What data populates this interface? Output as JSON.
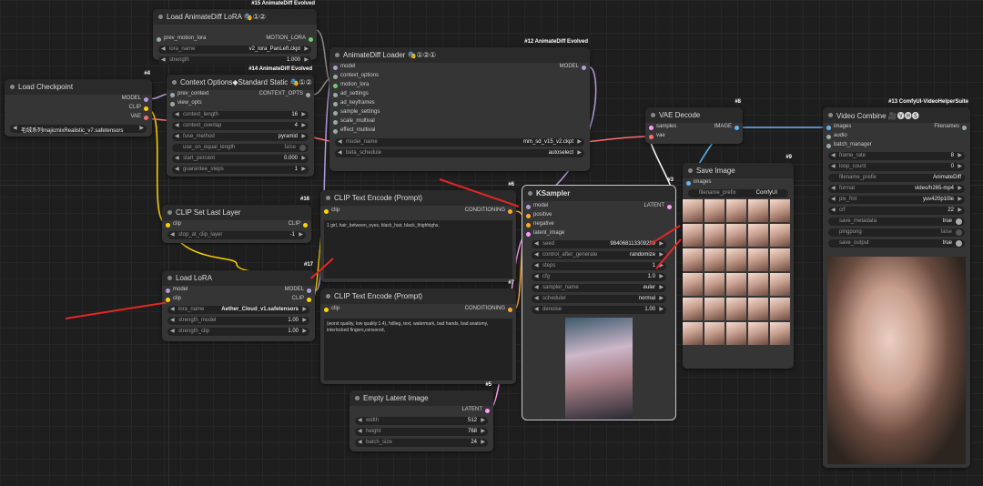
{
  "colors": {
    "canvas": "#1e1e1e",
    "node": "#353535",
    "arrow": "#e32626"
  },
  "nodes": {
    "lora_ad": {
      "badge": "#15 AnimateDiff Evolved",
      "title": "Load AnimateDiff LoRA 🎭①②",
      "in1": "prev_motion_lora",
      "out1": "MOTION_LORA",
      "w1n": "lora_name",
      "w1v": "v2_lora_PanLeft.ckpt",
      "w2n": "strength",
      "w2v": "1.000"
    },
    "ckpt": {
      "badge": "#4",
      "title": "Load Checkpoint",
      "o1": "MODEL",
      "o2": "CLIP",
      "o3": "VAE",
      "w1v": "毛绒系列majicmixRealistic_v7.safetensors"
    },
    "ctx": {
      "badge": "#14 AnimateDiff Evolved",
      "title": "Context Options◆Standard Static 🎭①②",
      "in1": "prev_context",
      "in2": "view_opts",
      "out1": "CONTEXT_OPTS",
      "w1n": "context_length",
      "w1v": "16",
      "w2n": "context_overlap",
      "w2v": "4",
      "w3n": "fuse_method",
      "w3v": "pyramid",
      "w4n": "use_on_equal_length",
      "w4v": "false",
      "w5n": "start_percent",
      "w5v": "0.000",
      "w6n": "guarantee_steps",
      "w6v": "1"
    },
    "adl": {
      "badge": "#12 AnimateDiff Evolved",
      "title": "AnimateDiff Loader 🎭①②①",
      "out1": "MODEL",
      "i1": "model",
      "i2": "context_options",
      "i3": "motion_lora",
      "i4": "ad_settings",
      "i5": "ad_keyframes",
      "i6": "sample_settings",
      "i7": "scale_multival",
      "i8": "effect_multival",
      "w1n": "model_name",
      "w1v": "mm_sd_v15_v2.ckpt",
      "w2n": "beta_schedule",
      "w2v": "autoselect"
    },
    "csl": {
      "badge": "#16",
      "title": "CLIP Set Last Layer",
      "in1": "clip",
      "out1": "CLIP",
      "w1n": "stop_at_clip_layer",
      "w1v": "-1"
    },
    "lora": {
      "badge": "#17",
      "title": "Load LoRA",
      "in1": "model",
      "in2": "clip",
      "out1": "MODEL",
      "out2": "CLIP",
      "w1n": "lora_name",
      "w1v": "Aether_Cloud_v1.safetensors",
      "w2n": "strength_model",
      "w2v": "1.00",
      "w3n": "strength_clip",
      "w3v": "1.00"
    },
    "pos": {
      "badge": "#6",
      "title": "CLIP Text Encode (Prompt)",
      "in1": "clip",
      "out1": "CONDITIONING",
      "text": "1 girl, hair_between_eyes, black_hair, black_thighhighs,"
    },
    "neg": {
      "badge": "#7",
      "title": "CLIP Text Encode (Prompt)",
      "in1": "clip",
      "out1": "CONDITIONING",
      "text": "(worst quality, low quality:1.4), hdlieg, text, watermark, bad hands, bad anatomy, interlocked fingers,censored,"
    },
    "empty": {
      "badge": "#5",
      "title": "Empty Latent Image",
      "out1": "LATENT",
      "w1n": "width",
      "w1v": "512",
      "w2n": "height",
      "w2v": "768",
      "w3n": "batch_size",
      "w3v": "24"
    },
    "ks": {
      "badge": "#3",
      "title": "KSampler",
      "out1": "LATENT",
      "i1": "model",
      "i2": "positive",
      "i3": "negative",
      "i4": "latent_image",
      "w1n": "seed",
      "w1v": "984068113309299",
      "w2n": "control_after_generate",
      "w2v": "randomize",
      "w3n": "steps",
      "w3v": "1",
      "w4n": "cfg",
      "w4v": "1.0",
      "w5n": "sampler_name",
      "w5v": "euler",
      "w6n": "scheduler",
      "w6v": "normal",
      "w7n": "denoise",
      "w7v": "1.00"
    },
    "vae": {
      "badge": "#8",
      "title": "VAE Decode",
      "in1": "samples",
      "in2": "vae",
      "out1": "IMAGE"
    },
    "save": {
      "badge": "#9",
      "title": "Save Image",
      "in1": "images",
      "w1n": "filename_prefix",
      "w1v": "ComfyUI"
    },
    "vc": {
      "badge": "#13 ComfyUI-VideoHelperSuite",
      "title": "Video Combine 🎥🅥🅗🅢",
      "in1": "images",
      "in2": "audio",
      "in3": "batch_manager",
      "out1": "Filenames",
      "w1n": "frame_rate",
      "w1v": "8",
      "w2n": "loop_count",
      "w2v": "0",
      "w3n": "filename_prefix",
      "w3v": "AnimateDiff",
      "w4n": "format",
      "w4v": "video/h265-mp4",
      "w5n": "pix_fmt",
      "w5v": "yuv420p10le",
      "w6n": "crf",
      "w6v": "22",
      "w7n": "save_metadata",
      "w7v": "true",
      "w8n": "pingpong",
      "w8v": "false",
      "w9n": "save_output",
      "w9v": "true"
    }
  }
}
